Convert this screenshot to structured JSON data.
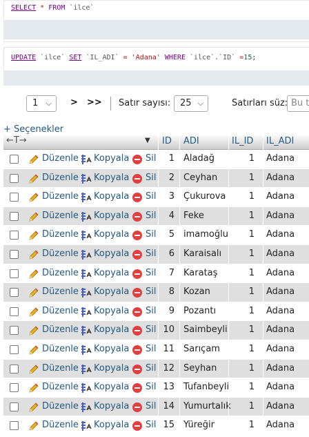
{
  "sql": {
    "select": {
      "kw1": "SELECT",
      "star": "*",
      "kw2": "FROM",
      "table": "`ilce`"
    },
    "update": {
      "kw1": "UPDATE",
      "table": "`ilce`",
      "kw2": "SET",
      "col": "`IL_ADI`",
      "eq": "=",
      "val": "'Adana'",
      "kw3": "WHERE",
      "ref": "`ilce`.`ID`",
      "eq2": "=",
      "num": "15",
      "semi": ";"
    }
  },
  "nav": {
    "page": "1",
    "next": ">",
    "last": ">>",
    "rows_label": "Satır sayısı:",
    "rows_value": "25",
    "filter_label": "Satırları süz:",
    "filter_placeholder": "Bu ta"
  },
  "options_link": "+ Seçenekler",
  "table": {
    "headers": {
      "arrows": "←T→",
      "id": "ID",
      "adi": "ADI",
      "il_id": "IL_ID",
      "il_adi": "IL_ADI"
    },
    "actions": {
      "edit": "Düzenle",
      "copy": "Kopyala",
      "delete": "Sil"
    },
    "rows": [
      {
        "id": "1",
        "adi": "Aladağ",
        "il_id": "1",
        "il_adi": "Adana"
      },
      {
        "id": "2",
        "adi": "Ceyhan",
        "il_id": "1",
        "il_adi": "Adana"
      },
      {
        "id": "3",
        "adi": "Çukurova",
        "il_id": "1",
        "il_adi": "Adana"
      },
      {
        "id": "4",
        "adi": "Feke",
        "il_id": "1",
        "il_adi": "Adana"
      },
      {
        "id": "5",
        "adi": "imamoğlu",
        "il_id": "1",
        "il_adi": "Adana"
      },
      {
        "id": "6",
        "adi": "Karaisalı",
        "il_id": "1",
        "il_adi": "Adana"
      },
      {
        "id": "7",
        "adi": "Karataş",
        "il_id": "1",
        "il_adi": "Adana"
      },
      {
        "id": "8",
        "adi": "Kozan",
        "il_id": "1",
        "il_adi": "Adana"
      },
      {
        "id": "9",
        "adi": "Pozantı",
        "il_id": "1",
        "il_adi": "Adana"
      },
      {
        "id": "10",
        "adi": "Saimbeyli",
        "il_id": "1",
        "il_adi": "Adana"
      },
      {
        "id": "11",
        "adi": "Sarıçam",
        "il_id": "1",
        "il_adi": "Adana"
      },
      {
        "id": "12",
        "adi": "Seyhan",
        "il_id": "1",
        "il_adi": "Adana"
      },
      {
        "id": "13",
        "adi": "Tufanbeyli",
        "il_id": "1",
        "il_adi": "Adana"
      },
      {
        "id": "14",
        "adi": "Yumurtalık",
        "il_id": "1",
        "il_adi": "Adana"
      },
      {
        "id": "15",
        "adi": "Yüreğir",
        "il_id": "1",
        "il_adi": "Adana"
      }
    ]
  },
  "colors": {
    "link": "#235a81",
    "row_alt": "#dfdfdf",
    "sql_bar": "#e4e8ef"
  }
}
